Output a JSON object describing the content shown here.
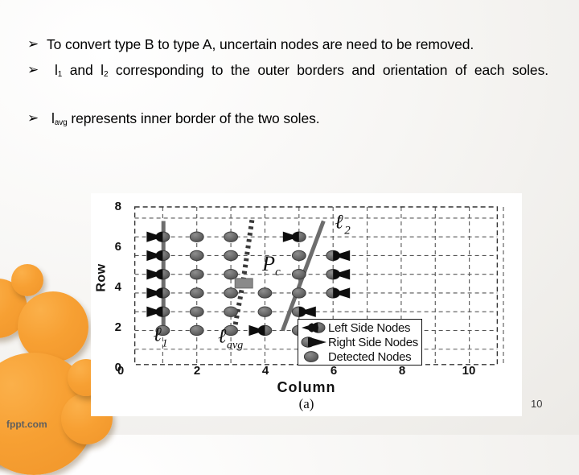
{
  "slide": {
    "number": "10",
    "watermark": "fppt.com",
    "bullet_glyph": "➢",
    "bullets": [
      {
        "text_before": "To convert type B to type A, uncertain nodes are need to be removed.",
        "symbol": "",
        "sub": "",
        "text_after": ""
      },
      {
        "text_before": "",
        "symbol": "l",
        "sub": "1",
        "text_after": " and ",
        "symbol2": "l",
        "sub2": "2",
        "text_after2": " corresponding to the outer borders and orientation of each soles."
      },
      {
        "text_before": "",
        "symbol": "l",
        "sub": "avg",
        "text_after": " represents inner border of the two soles."
      }
    ]
  },
  "figure": {
    "caption": "(a)",
    "xlabel": "Column",
    "ylabel": "Row",
    "annotations": [
      {
        "name": "l1",
        "base": "ℓ",
        "sub": "1"
      },
      {
        "name": "lavg",
        "base": "ℓ",
        "sub": "avg"
      },
      {
        "name": "l2",
        "base": "ℓ",
        "sub": "2"
      },
      {
        "name": "Pc",
        "base": "P",
        "sub": "c"
      }
    ],
    "legend": {
      "items": [
        {
          "key": "left-node",
          "label": "Left Side Nodes"
        },
        {
          "key": "right-node",
          "label": "Right Side Nodes"
        },
        {
          "key": "detected-node",
          "label": "Detected Nodes"
        }
      ]
    }
  },
  "chart_data": {
    "type": "scatter",
    "title": "",
    "xlabel": "Column",
    "ylabel": "Row",
    "xlim": [
      0,
      11
    ],
    "ylim": [
      0,
      8.6
    ],
    "xticks": [
      0,
      2,
      4,
      6,
      8,
      10
    ],
    "yticks": [
      0,
      2,
      4,
      6,
      8
    ],
    "grid": true,
    "grid_style": "dashed",
    "grid_step": 1,
    "legend_position": "bottom-right",
    "series": [
      {
        "name": "Left Side Nodes",
        "marker": "left-arrow-with-ellipse",
        "points": [
          [
            1,
            7
          ],
          [
            1,
            6
          ],
          [
            1,
            5
          ],
          [
            1,
            4
          ],
          [
            1,
            3
          ],
          [
            5,
            7
          ],
          [
            4,
            2
          ]
        ]
      },
      {
        "name": "Right Side Nodes",
        "marker": "right-arrow-with-ellipse",
        "points": [
          [
            6,
            6
          ],
          [
            6,
            5
          ],
          [
            6,
            4
          ],
          [
            5,
            3
          ],
          [
            5,
            2
          ]
        ]
      },
      {
        "name": "Detected Nodes",
        "marker": "ellipse",
        "points": [
          [
            1,
            7
          ],
          [
            2,
            7
          ],
          [
            3,
            7
          ],
          [
            5,
            7
          ],
          [
            1,
            6
          ],
          [
            2,
            6
          ],
          [
            3,
            6
          ],
          [
            5,
            6
          ],
          [
            6,
            6
          ],
          [
            1,
            5
          ],
          [
            2,
            5
          ],
          [
            3,
            5
          ],
          [
            5,
            5
          ],
          [
            6,
            5
          ],
          [
            1,
            4
          ],
          [
            2,
            4
          ],
          [
            3,
            4
          ],
          [
            4,
            4
          ],
          [
            5,
            4
          ],
          [
            6,
            4
          ],
          [
            1,
            3
          ],
          [
            2,
            3
          ],
          [
            3,
            3
          ],
          [
            4,
            3
          ],
          [
            5,
            3
          ],
          [
            1,
            2
          ],
          [
            2,
            2
          ],
          [
            3,
            2
          ],
          [
            4,
            2
          ],
          [
            5,
            2
          ]
        ]
      }
    ],
    "lines": [
      {
        "name": "l1",
        "style": "solid",
        "color": "#6d6d6d",
        "width": 5,
        "points": [
          [
            1.02,
            7.85
          ],
          [
            1.02,
            2.0
          ]
        ]
      },
      {
        "name": "lavg",
        "style": "dotted",
        "color": "#3a3a3a",
        "width": 6,
        "points": [
          [
            3.62,
            7.9
          ],
          [
            3.35,
            4.5
          ],
          [
            3.1,
            2.0
          ]
        ]
      },
      {
        "name": "l2",
        "style": "solid",
        "color": "#6d6d6d",
        "width": 5,
        "points": [
          [
            4.52,
            2.0
          ],
          [
            5.72,
            7.85
          ]
        ]
      }
    ],
    "markers": [
      {
        "name": "Pc",
        "shape": "square",
        "x": 3.38,
        "y": 4.52,
        "color": "#8a8a8a"
      }
    ],
    "annotations": [
      {
        "text": "l1",
        "x": 0.72,
        "y": 1.45
      },
      {
        "text": "lavg",
        "x": 2.62,
        "y": 1.35
      },
      {
        "text": "l2",
        "x": 6.05,
        "y": 7.45
      },
      {
        "text": "Pc",
        "x": 3.92,
        "y": 5.2
      }
    ]
  }
}
